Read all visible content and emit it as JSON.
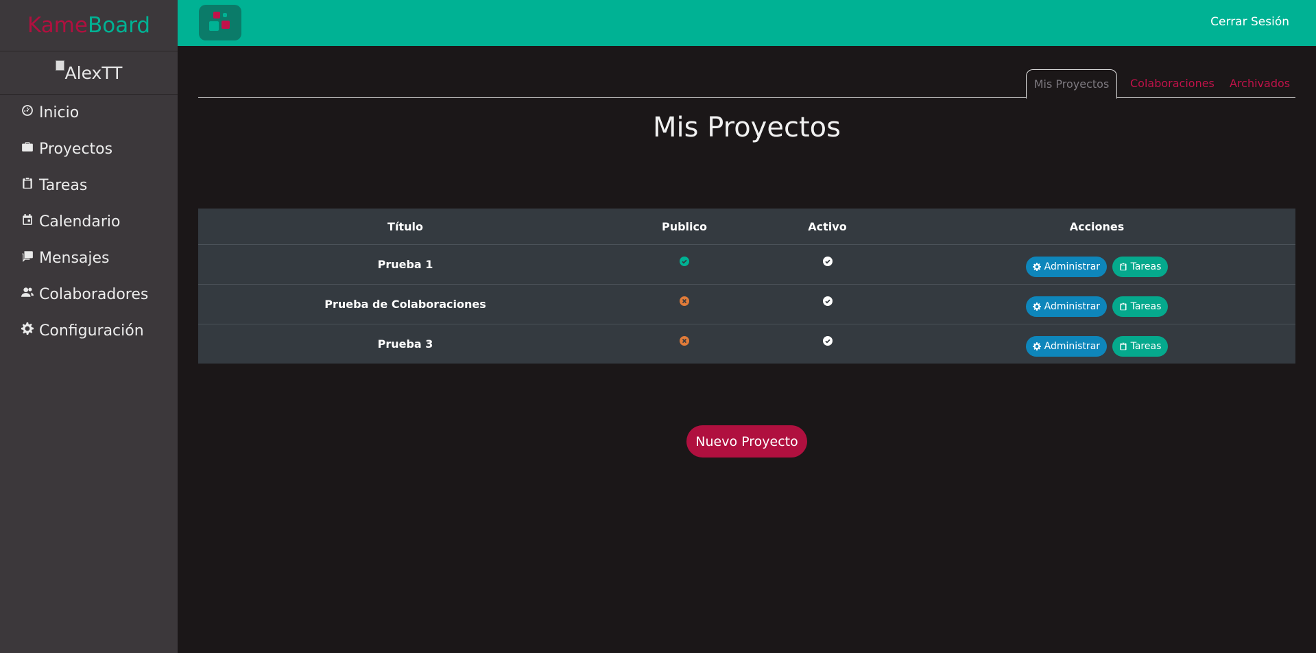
{
  "brand": {
    "part1": "Kame",
    "part2": "Board"
  },
  "user": {
    "avatar_alt": "AlexTT"
  },
  "sidebar": {
    "items": [
      {
        "label": "Inicio",
        "icon": "dashboard-icon"
      },
      {
        "label": "Proyectos",
        "icon": "briefcase-icon"
      },
      {
        "label": "Tareas",
        "icon": "clipboard-icon"
      },
      {
        "label": "Calendario",
        "icon": "calendar-icon"
      },
      {
        "label": "Mensajes",
        "icon": "messages-icon"
      },
      {
        "label": "Colaboradores",
        "icon": "users-icon"
      },
      {
        "label": "Configuración",
        "icon": "gear-icon"
      }
    ]
  },
  "header": {
    "logout_label": "Cerrar Sesión"
  },
  "tabs": [
    {
      "label": "Mis Proyectos",
      "active": true
    },
    {
      "label": "Colaboraciones",
      "active": false
    },
    {
      "label": "Archivados",
      "active": false
    }
  ],
  "main": {
    "title": "Mis Proyectos",
    "table": {
      "headers": [
        "Título",
        "Publico",
        "Activo",
        "Acciones"
      ],
      "rows": [
        {
          "title": "Prueba 1",
          "public": true,
          "active": true
        },
        {
          "title": "Prueba de Colaboraciones",
          "public": false,
          "active": true
        },
        {
          "title": "Prueba 3",
          "public": false,
          "active": true
        }
      ],
      "actions": {
        "admin_label": "Administrar",
        "tasks_label": "Tareas"
      }
    },
    "new_project_label": "Nuevo Proyecto"
  },
  "colors": {
    "topbar": "#00b294",
    "sidebar": "#3c383b",
    "background": "#1b1718",
    "accent": "#b0103f",
    "admin_button": "#0e86bb",
    "tasks_button": "#05a98d",
    "status_yes": "#00b294",
    "status_no": "#e07b39"
  }
}
